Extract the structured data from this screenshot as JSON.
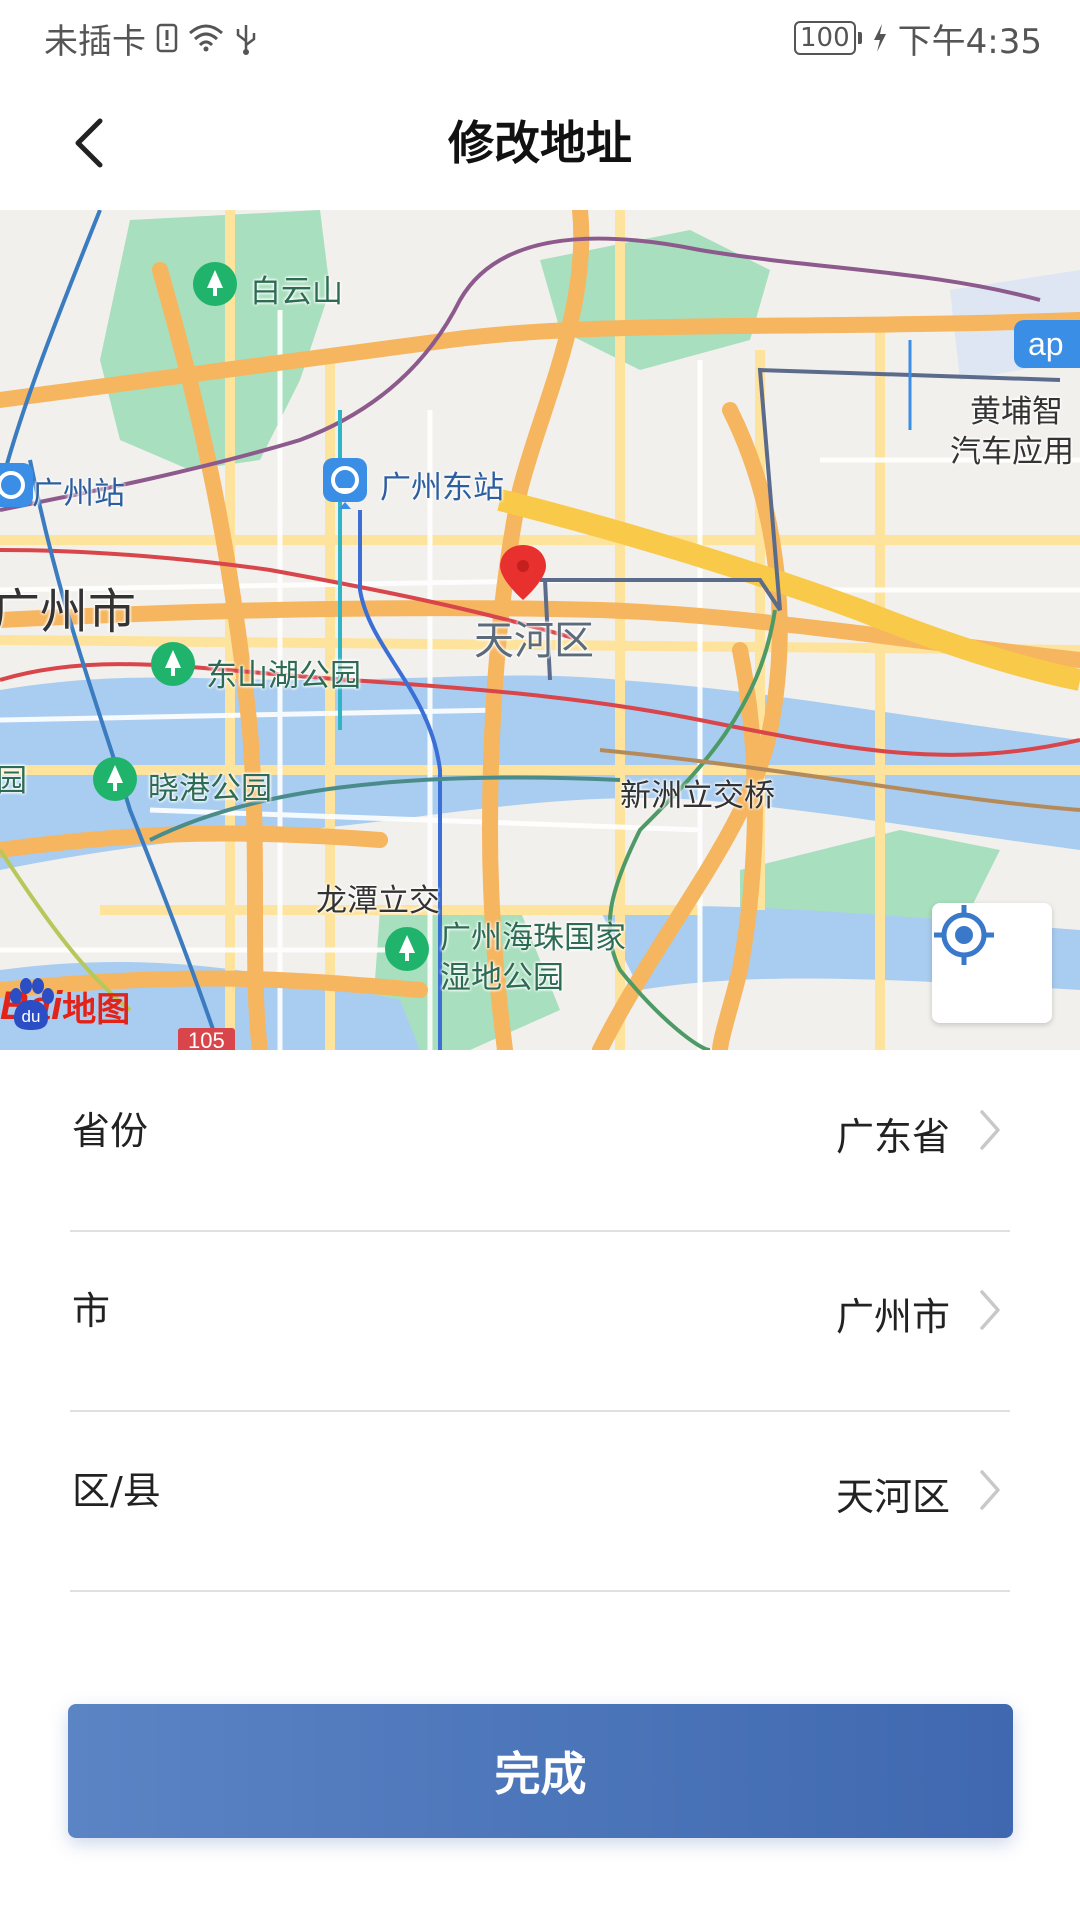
{
  "status_bar": {
    "carrier": "未插卡",
    "battery": "100",
    "time": "下午4:35",
    "icons": [
      "sim-alert-icon",
      "wifi-icon",
      "usb-icon",
      "battery-icon",
      "charging-icon"
    ]
  },
  "header": {
    "title": "修改地址",
    "back_icon": "chevron-left-icon"
  },
  "map": {
    "labels": {
      "baiyunshan": "白云山",
      "guangzhou_east": "广州东站",
      "guangzhou_station": "广州站",
      "guangzhou_city": "广州市",
      "tianhe": "天河区",
      "dongshanhu": "东山湖公园",
      "xiaogang": "晓港公园",
      "xinzhou": "新洲立交桥",
      "longtan": "龙潭立交",
      "haizhu_1": "广州海珠国家",
      "haizhu_2": "湿地公园",
      "huangpu_1": "黄埔智",
      "huangpu_2": "汽车应用",
      "left_edge": "园",
      "app_badge": "ap",
      "road_shield": "105"
    },
    "logo": {
      "brand": "Bai",
      "paw_text": "du",
      "suffix": "地图"
    },
    "locate_icon": "locate-target-icon",
    "marker_icon": "location-marker-icon",
    "colors": {
      "water": "#a9cdf0",
      "green": "#a8dfbe",
      "road_major": "#f6b55f",
      "road_minor": "#fde39c",
      "marker": "#e8312f",
      "poi_green": "#1fb36b",
      "station_blue": "#3a8ee6"
    }
  },
  "form": {
    "province": {
      "label": "省份",
      "value": "广东省"
    },
    "city": {
      "label": "市",
      "value": "广州市"
    },
    "district": {
      "label": "区/县",
      "value": "天河区"
    }
  },
  "submit_label": "完成",
  "colors": {
    "button_start": "#5a84c4",
    "button_end": "#3f68b0",
    "divider": "#e0e0e0"
  }
}
